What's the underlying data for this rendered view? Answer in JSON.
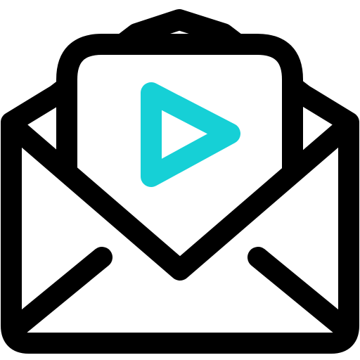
{
  "icon": {
    "name": "envelope-video-icon",
    "parts": [
      "open-envelope-icon",
      "letter-sheet-icon",
      "play-triangle-icon"
    ]
  },
  "colors": {
    "outline": "#000000",
    "accent": "#16d0d6",
    "background": "#ffffff"
  }
}
